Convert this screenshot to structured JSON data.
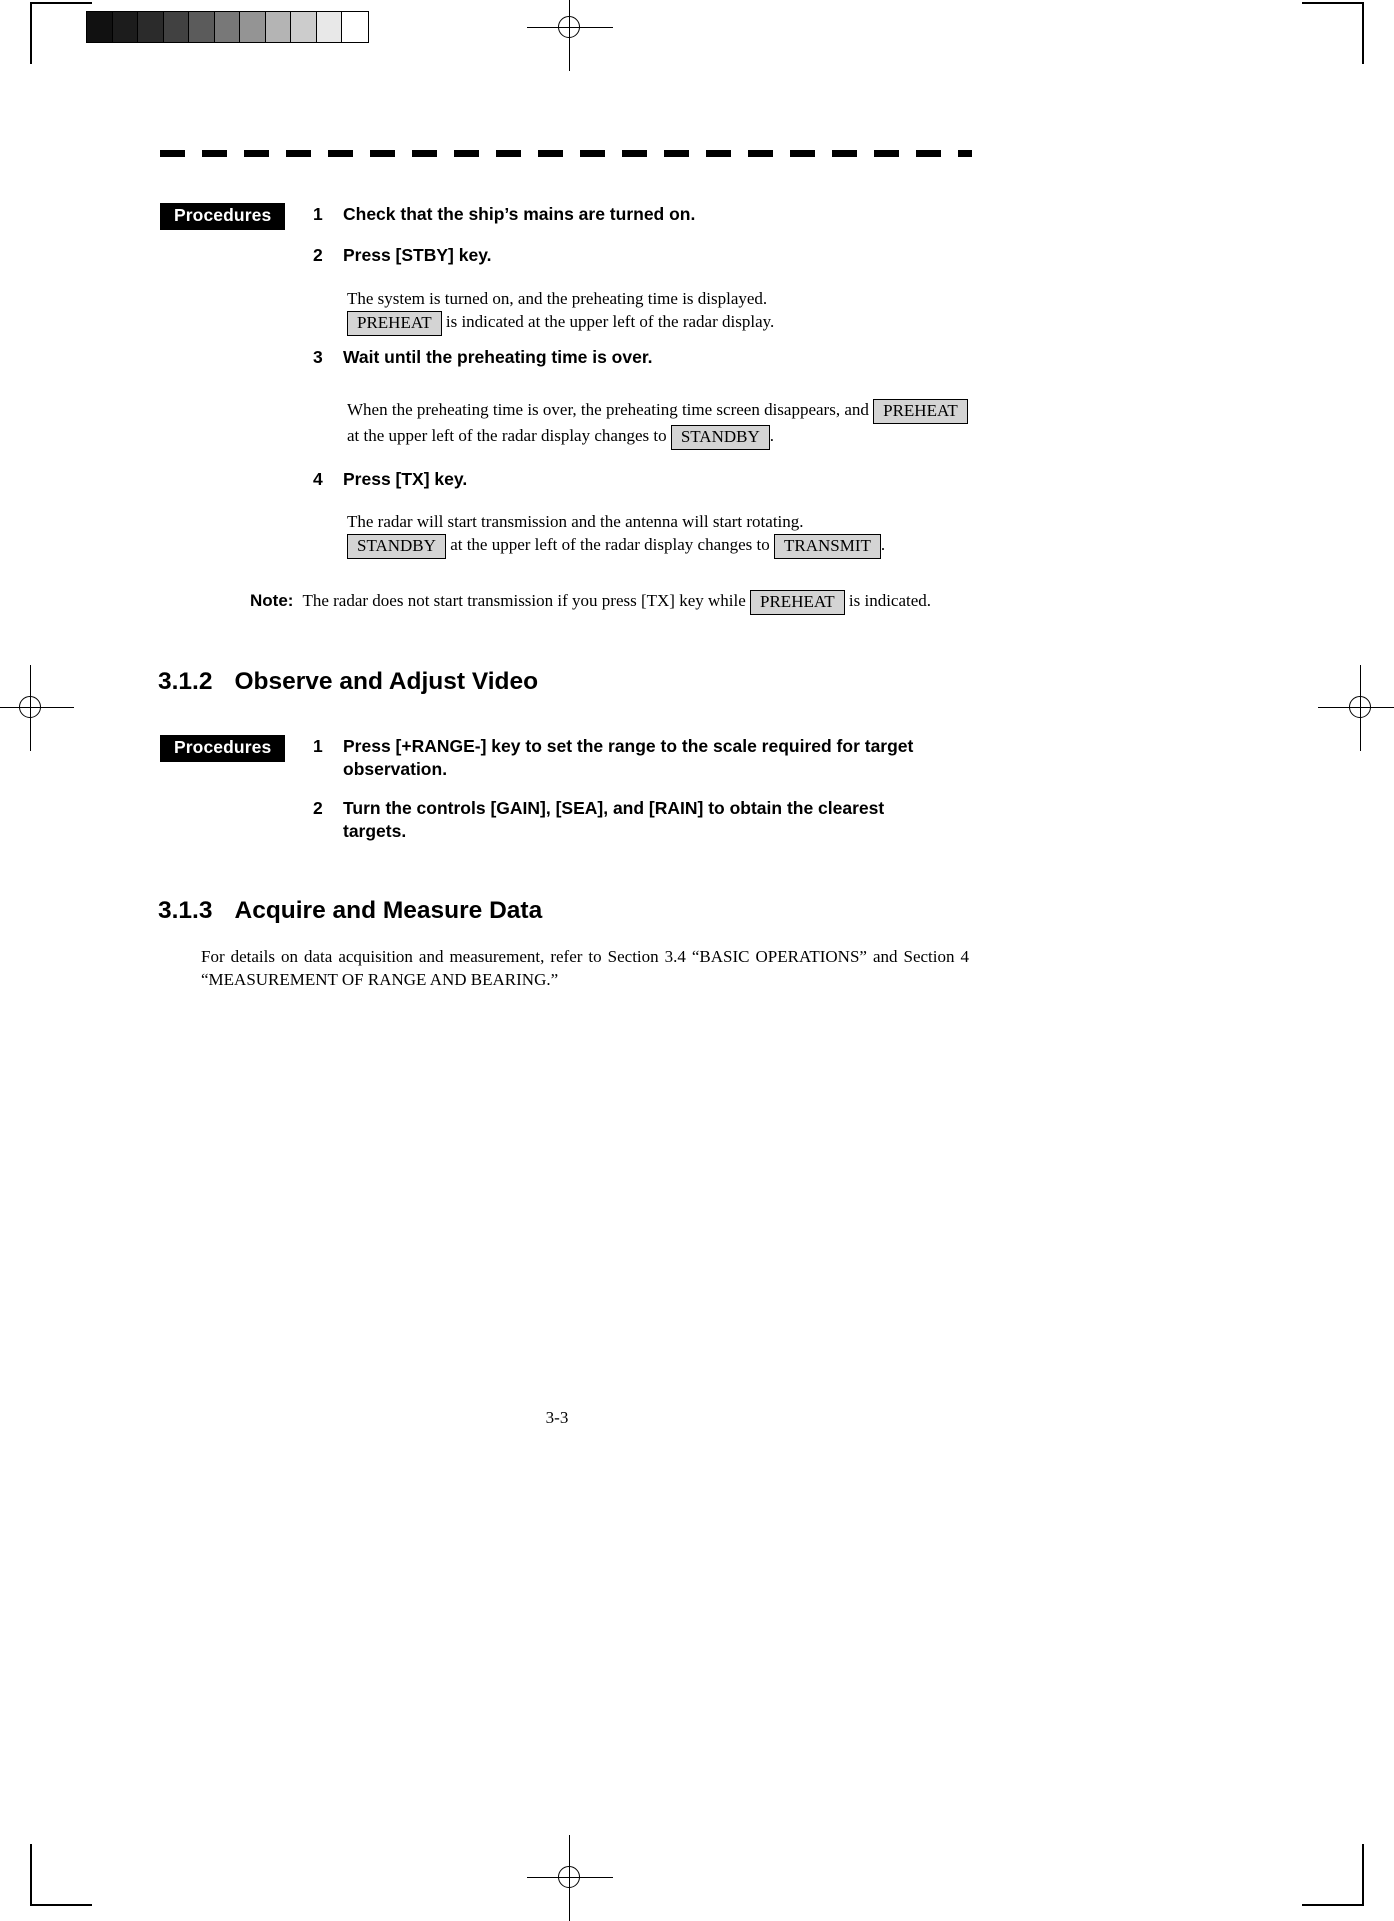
{
  "scan": {
    "grayscale_strip": {
      "name": "grayscale-calibration-strip",
      "swatches": [
        "#111111",
        "#1c1c1c",
        "#2b2b2b",
        "#414141",
        "#5b5b5b",
        "#787878",
        "#949494",
        "#b4b4b4",
        "#cccccc",
        "#e8e8e8",
        "#ffffff"
      ]
    }
  },
  "section_31_1": {
    "procedures_tag": "Procedures",
    "steps": [
      {
        "num": "1",
        "text": "Check that the ship’s mains are turned on."
      },
      {
        "num": "2",
        "text": "Press [STBY] key."
      },
      {
        "num": "3",
        "text": "Wait until the preheating time is over."
      },
      {
        "num": "4",
        "text": "Press [TX] key."
      }
    ],
    "step2_body": {
      "line1": "The system is turned on, and the preheating time is displayed.",
      "indicator": "PREHEAT",
      "line2_after": "is indicated at the upper left of the radar display."
    },
    "step3_body": {
      "line1_before": "When the preheating time is over, the preheating time screen disappears, and",
      "indicator_1": "PREHEAT",
      "line2_before": "at the upper left of the radar display changes to",
      "indicator_2": "STANDBY",
      "line2_after": "."
    },
    "step4_body": {
      "line1": "The radar will start transmission and the antenna will start rotating.",
      "indicator_1": "STANDBY",
      "line2_mid": "at the upper left of the radar display changes to",
      "indicator_2": "TRANSMIT",
      "line2_after": "."
    },
    "note": {
      "label": "Note:",
      "text_before": "The radar does not start transmission if you press [TX] key while",
      "indicator": "PREHEAT",
      "text_after": "is indicated."
    }
  },
  "section_31_2": {
    "number": "3.1.2",
    "title": "Observe and Adjust Video",
    "procedures_tag": "Procedures",
    "steps": [
      {
        "num": "1",
        "text": "Press [+RANGE-] key to set the range to the scale required for target observation."
      },
      {
        "num": "2",
        "text": "Turn the controls [GAIN], [SEA], and [RAIN] to obtain the clearest targets."
      }
    ]
  },
  "section_31_3": {
    "number": "3.1.3",
    "title": "Acquire and Measure Data",
    "paragraph": "For details on data acquisition and measurement, refer to Section 3.4 “BASIC OPERATIONS” and Section 4 “MEASUREMENT OF RANGE AND BEARING.”"
  },
  "footer": {
    "page_number": "3-3"
  }
}
